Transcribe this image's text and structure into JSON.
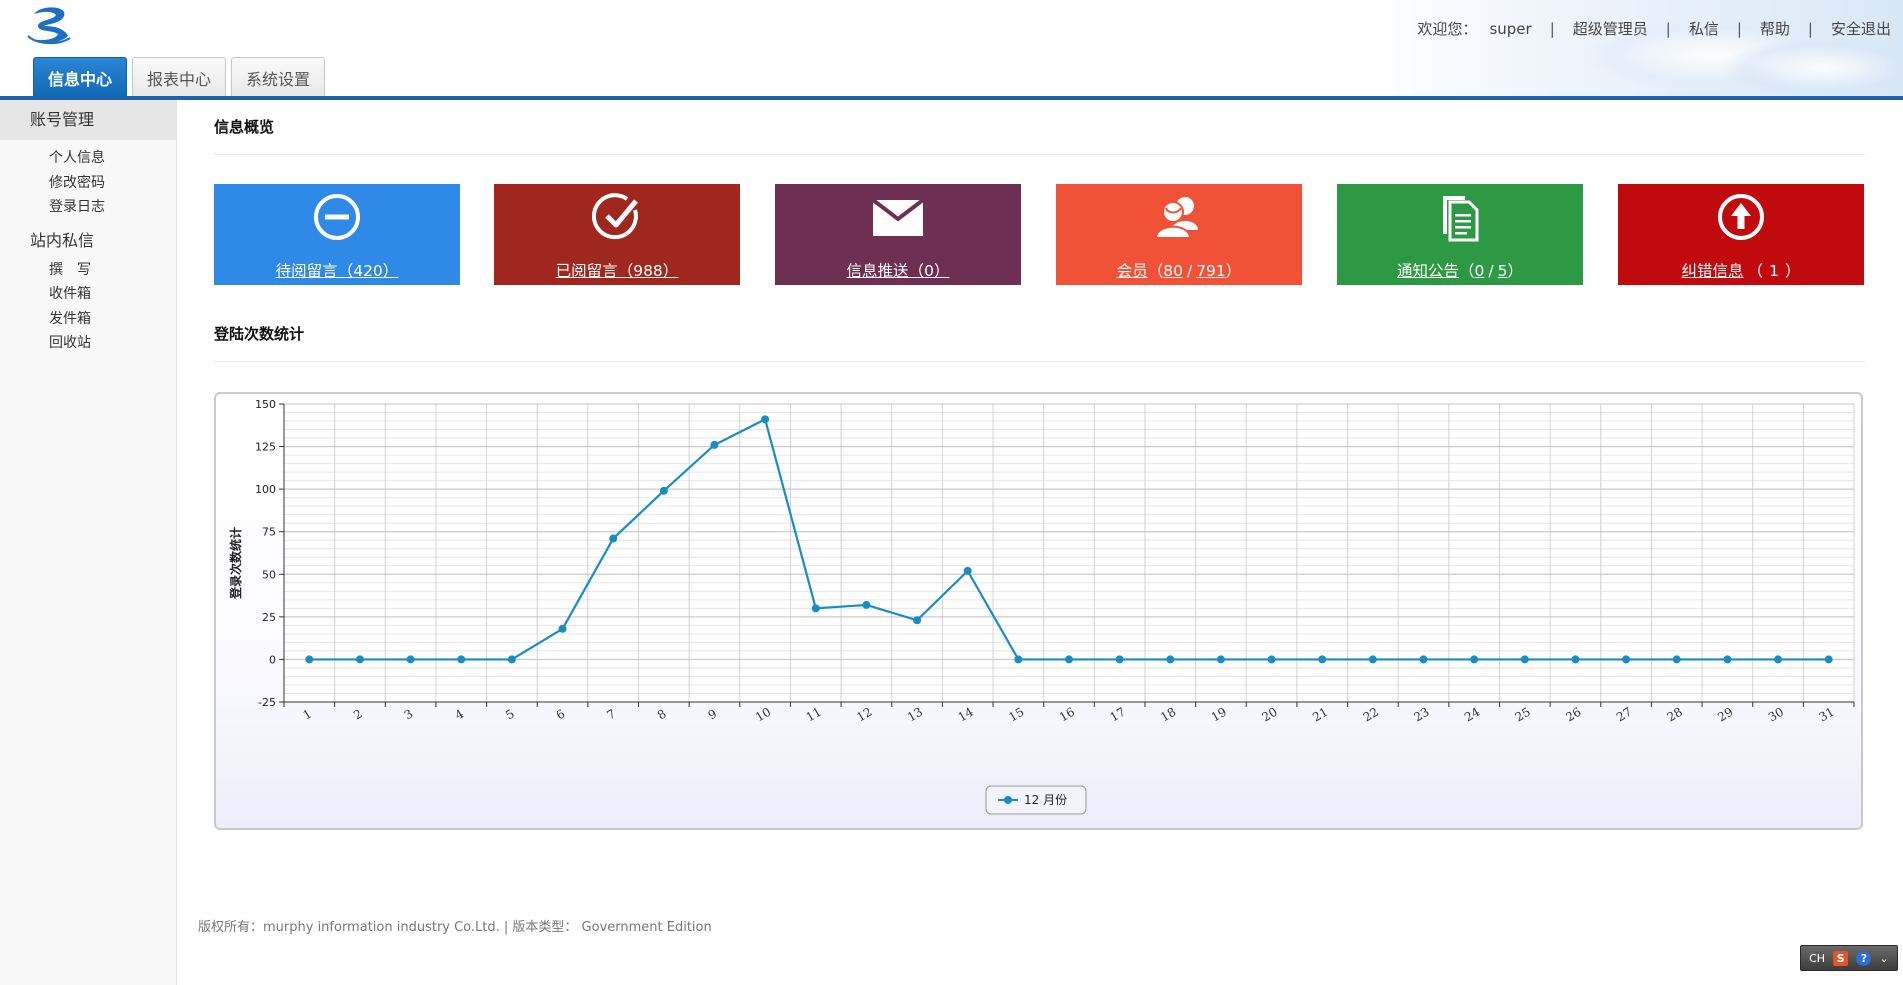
{
  "header": {
    "welcome_label": "欢迎您：",
    "username": "super",
    "role": "超级管理员",
    "sep": "|",
    "links": [
      "私信",
      "帮助",
      "安全退出"
    ]
  },
  "nav": {
    "tabs": [
      {
        "label": "信息中心",
        "active": true
      },
      {
        "label": "报表中心",
        "active": false
      },
      {
        "label": "系统设置",
        "active": false
      }
    ]
  },
  "sidebar": {
    "groups": [
      {
        "title": "账号管理",
        "items": [
          "个人信息",
          "修改密码",
          "登录日志"
        ]
      },
      {
        "title": "站内私信",
        "items": [
          "撰　写",
          "收件箱",
          "发件箱",
          "回收站"
        ]
      }
    ]
  },
  "overview": {
    "title": "信息概览",
    "cards": [
      {
        "label": "待阅留言",
        "paren_open": "（",
        "value": "420",
        "paren_close": "）",
        "color": "#2e8ae6",
        "icon": "minus-circle-icon"
      },
      {
        "label": "已阅留言",
        "paren_open": "（",
        "value": "988",
        "paren_close": "）",
        "color": "#a0271d",
        "icon": "check-circle-icon"
      },
      {
        "label": "信息推送",
        "paren_open": "（",
        "value": "0",
        "paren_close": "）",
        "color": "#6e2f53",
        "icon": "envelope-icon"
      },
      {
        "label": "会员",
        "paren_open": "（",
        "value": "80",
        "slash": "/",
        "value2": "791",
        "paren_close": "）",
        "color": "#f15137",
        "icon": "users-icon"
      },
      {
        "label": "通知公告",
        "paren_open": "（",
        "value": "0",
        "slash": "/",
        "value2": "5",
        "paren_close": "）",
        "color": "#2e9944",
        "icon": "documents-icon"
      },
      {
        "label": "纠错信息",
        "paren_open": "（",
        "value": "1",
        "paren_close": "）",
        "color": "#c10a0e",
        "icon": "arrow-up-circle-icon"
      }
    ]
  },
  "login_stats": {
    "title": "登陆次数统计"
  },
  "chart_data": {
    "type": "line",
    "ylabel": "登录次数统计",
    "xlabel": "",
    "ylim": [
      -25,
      150
    ],
    "yticks": [
      -25,
      0,
      25,
      50,
      75,
      100,
      125,
      150
    ],
    "x": [
      1,
      2,
      3,
      4,
      5,
      6,
      7,
      8,
      9,
      10,
      11,
      12,
      13,
      14,
      15,
      16,
      17,
      18,
      19,
      20,
      21,
      22,
      23,
      24,
      25,
      26,
      27,
      28,
      29,
      30,
      31
    ],
    "series": [
      {
        "name": "12 月份",
        "color": "#1a8cc4",
        "values": [
          0,
          0,
          0,
          0,
          0,
          18,
          71,
          99,
          126,
          141,
          30,
          32,
          23,
          52,
          0,
          0,
          0,
          0,
          0,
          0,
          0,
          0,
          0,
          0,
          0,
          0,
          0,
          0,
          0,
          0,
          0
        ]
      }
    ],
    "grid": true,
    "legend": "bottom-center"
  },
  "footer": {
    "text": "版权所有：murphy information industry Co.Ltd. | 版本类型： Government Edition"
  },
  "tray": {
    "lang": "CH",
    "s": "S",
    "q": "?"
  }
}
